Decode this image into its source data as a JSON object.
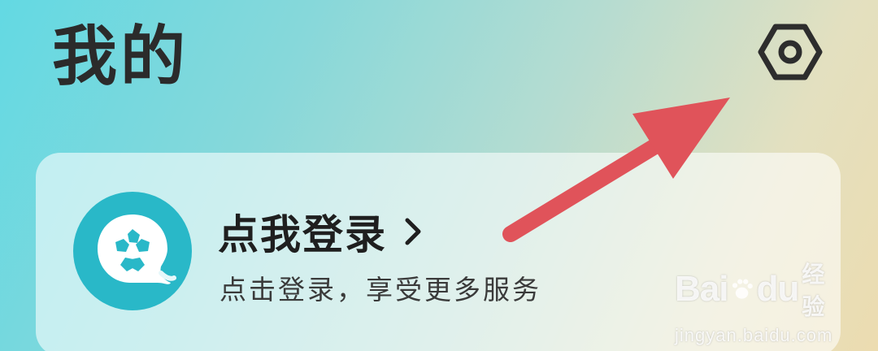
{
  "header": {
    "title": "我的",
    "settings_icon": "settings-hexagon-icon"
  },
  "login_card": {
    "title": "点我登录",
    "subtitle": "点击登录，享受更多服务",
    "avatar_icon": "default-avatar-icon",
    "chevron_icon": "chevron-right-icon"
  },
  "annotation": {
    "arrow_color": "#e0535a"
  },
  "watermark": {
    "brand_prefix": "Bai",
    "brand_suffix": "du",
    "brand_sub": "经验",
    "url": "jingyan.baidu.com"
  },
  "colors": {
    "avatar_teal": "#29b8c8",
    "text_dark": "#2b2b2b"
  }
}
